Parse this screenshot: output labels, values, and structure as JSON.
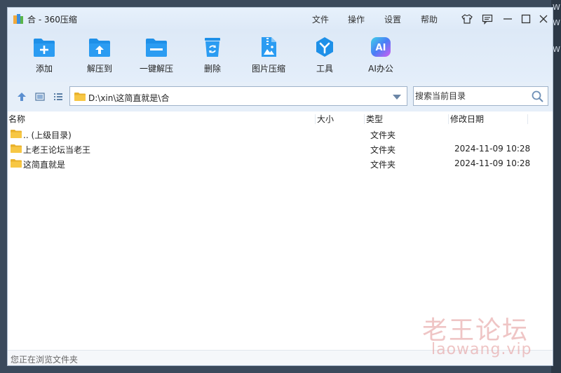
{
  "window": {
    "title": "合 - 360压缩",
    "menus": [
      "文件",
      "操作",
      "设置",
      "帮助"
    ],
    "title_icons": [
      "shirt-icon",
      "feedback-icon",
      "minimize-icon",
      "maximize-icon",
      "close-icon"
    ]
  },
  "toolbar": {
    "items": [
      {
        "label": "添加",
        "icon": "add-folder-icon"
      },
      {
        "label": "解压到",
        "icon": "extract-to-icon"
      },
      {
        "label": "一键解压",
        "icon": "one-click-extract-icon"
      },
      {
        "label": "删除",
        "icon": "recycle-bin-icon"
      },
      {
        "label": "图片压缩",
        "icon": "image-compress-icon"
      },
      {
        "label": "工具",
        "icon": "tools-icon"
      },
      {
        "label": "AI办公",
        "icon": "ai-office-icon"
      }
    ],
    "ai_badge": "AI"
  },
  "addressbar": {
    "path": "D:\\xin\\这简直就是\\合",
    "search_placeholder": "搜索当前目录"
  },
  "columns": {
    "name": "名称",
    "size": "大小",
    "type": "类型",
    "modified": "修改日期"
  },
  "files": [
    {
      "name": ".. (上级目录)",
      "size": "",
      "type": "文件夹",
      "modified": ""
    },
    {
      "name": "上老王论坛当老王",
      "size": "",
      "type": "文件夹",
      "modified": "2024-11-09 10:28"
    },
    {
      "name": "这简直就是",
      "size": "",
      "type": "文件夹",
      "modified": "2024-11-09 10:28"
    }
  ],
  "status": "您正在浏览文件夹",
  "watermark": {
    "cn": "老王论坛",
    "en": "laowang.vip"
  },
  "colors": {
    "accent_blue": "#1e90e8",
    "folder_yellow": "#f7c744",
    "titlebar_bg": "#e3eefb"
  }
}
